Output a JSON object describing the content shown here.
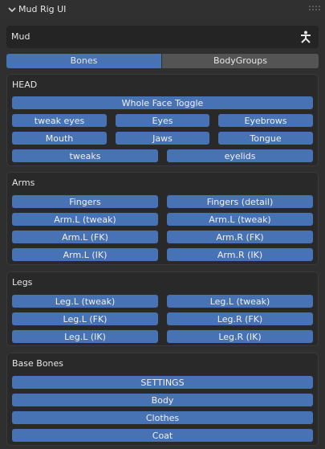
{
  "panel": {
    "title": "Mud Rig UI"
  },
  "rig": {
    "name": "Mud",
    "icon": "armature-icon"
  },
  "tabs": [
    {
      "label": "Bones",
      "active": true
    },
    {
      "label": "BodyGroups",
      "active": false
    }
  ],
  "head": {
    "heading": "HEAD",
    "whole_face_toggle": "Whole Face Toggle",
    "row1": [
      "tweak eyes",
      "Eyes",
      "Eyebrows"
    ],
    "row2": [
      "Mouth",
      "Jaws",
      "Tongue"
    ],
    "row3": [
      "tweaks",
      "eyelids"
    ]
  },
  "arms": {
    "heading": "Arms",
    "rows": [
      [
        "Fingers",
        "Fingers (detail)"
      ],
      [
        "Arm.L (tweak)",
        "Arm.L (tweak)"
      ],
      [
        "Arm.L (FK)",
        "Arm.R (FK)"
      ],
      [
        "Arm.L (IK)",
        "Arm.R (IK)"
      ]
    ]
  },
  "legs": {
    "heading": "Legs",
    "rows": [
      [
        "Leg.L (tweak)",
        "Leg.L (tweak)"
      ],
      [
        "Leg.L (FK)",
        "Leg.R (FK)"
      ],
      [
        "Leg.L (IK)",
        "Leg.R (IK)"
      ]
    ]
  },
  "base": {
    "heading": "Base Bones",
    "items": [
      "SETTINGS",
      "Body",
      "Clothes",
      "Coat"
    ]
  },
  "colors": {
    "button": "#4772b3",
    "background": "#2f2f2f",
    "box": "#292929"
  }
}
